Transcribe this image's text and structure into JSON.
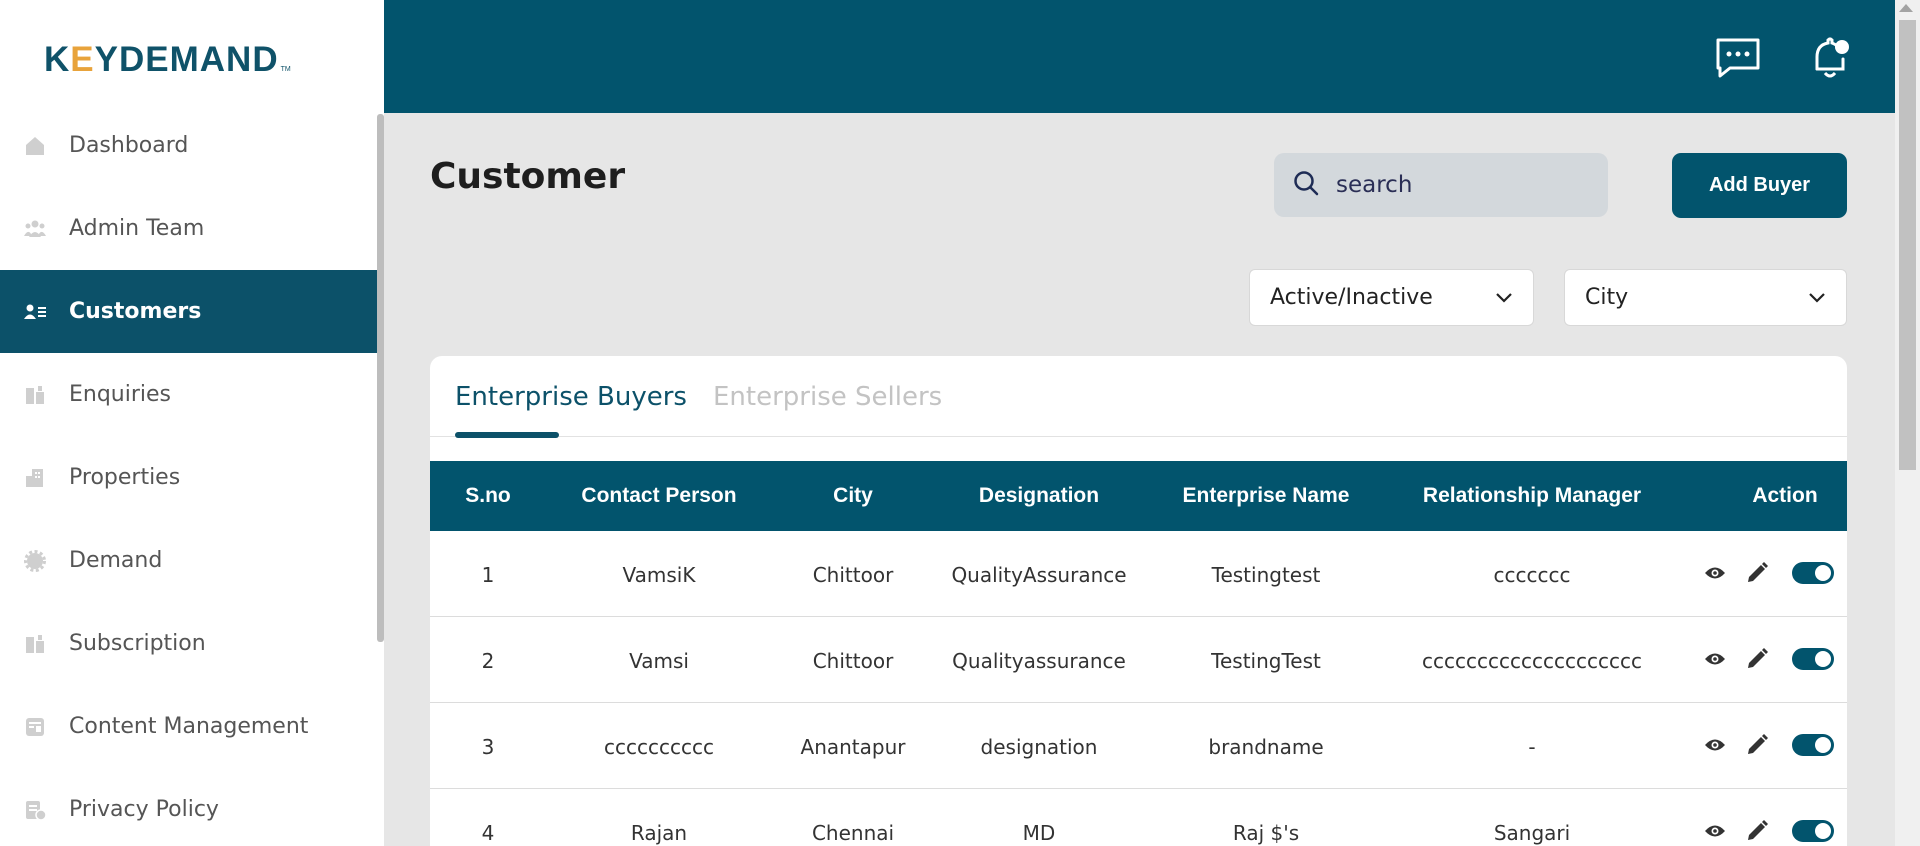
{
  "logo": {
    "text_a": "K",
    "text_dot": "E",
    "text_b": "YDEMAND",
    "tm": "TM"
  },
  "sidebar": {
    "items": [
      {
        "label": "Dashboard",
        "icon": "home-icon"
      },
      {
        "label": "Admin Team",
        "icon": "team-icon"
      },
      {
        "label": "Customers",
        "icon": "customers-icon",
        "active": true
      },
      {
        "label": "Enquiries",
        "icon": "enquiries-icon"
      },
      {
        "label": "Properties",
        "icon": "building-icon"
      },
      {
        "label": "Demand",
        "icon": "gear-icon"
      },
      {
        "label": "Subscription",
        "icon": "subscription-icon"
      },
      {
        "label": "Content Management",
        "icon": "content-icon"
      },
      {
        "label": "Privacy Policy",
        "icon": "privacy-icon"
      }
    ]
  },
  "header": {
    "chat_icon": "chat-icon",
    "bell_icon": "bell-icon"
  },
  "main": {
    "title": "Customer",
    "search": {
      "placeholder": "search",
      "value": ""
    },
    "add_button": "Add Buyer",
    "filters": {
      "status": "Active/Inactive",
      "city": "City"
    },
    "tabs": [
      {
        "label": "Enterprise Buyers",
        "active": true
      },
      {
        "label": "Enterprise Sellers",
        "active": false
      }
    ]
  },
  "table": {
    "columns": [
      "S.no",
      "Contact Person",
      "City",
      "Designation",
      "Enterprise Name",
      "Relationship Manager",
      "Action"
    ],
    "rows": [
      {
        "sno": "1",
        "contact": "VamsiK",
        "city": "Chittoor",
        "designation": "QualityAssurance",
        "enterprise": "Testingtest",
        "manager": "ccccccc",
        "active": true
      },
      {
        "sno": "2",
        "contact": "Vamsi",
        "city": "Chittoor",
        "designation": "Qualityassurance",
        "enterprise": "TestingTest",
        "manager": "cccccccccccccccccccc",
        "active": true
      },
      {
        "sno": "3",
        "contact": "cccccccccc",
        "city": "Anantapur",
        "designation": "designation",
        "enterprise": "brandname",
        "manager": "-",
        "active": true
      },
      {
        "sno": "4",
        "contact": "Rajan",
        "city": "Chennai",
        "designation": "MD",
        "enterprise": "Raj $'s",
        "manager": "Sangari",
        "active": true
      }
    ]
  },
  "colors": {
    "primary": "#02546d",
    "accent": "#e8a33b",
    "background": "#e6e6e6"
  }
}
